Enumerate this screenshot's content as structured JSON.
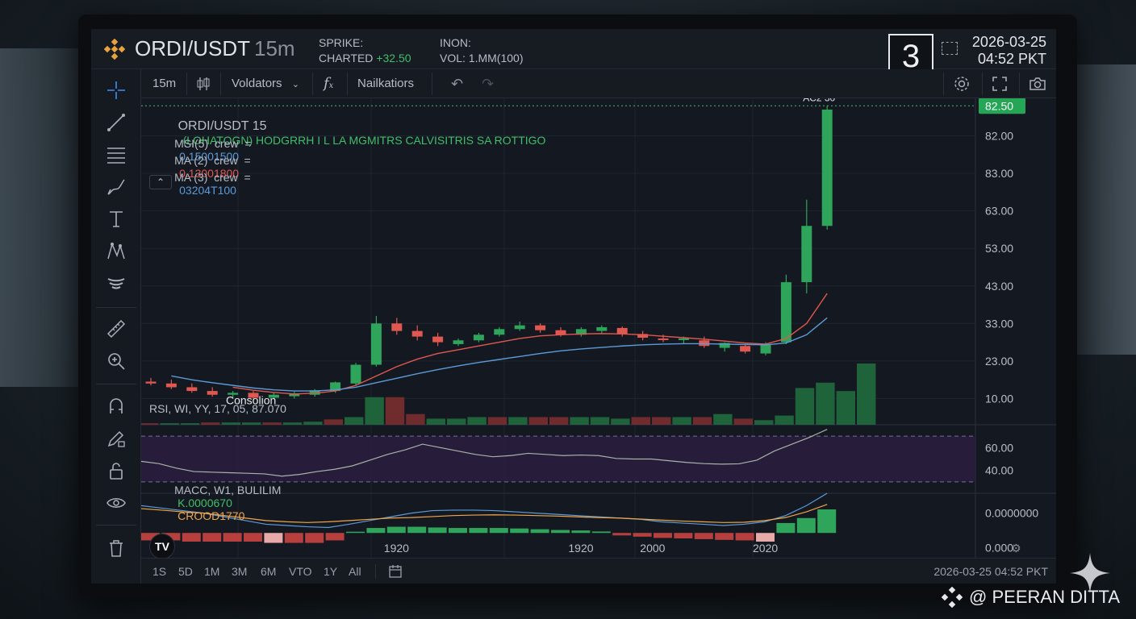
{
  "header": {
    "symbol": "ORDI/USDT",
    "timeframe": "15m",
    "block1_label": "SPRIKE:",
    "block1_line2_label": "CHARTED",
    "block1_change": "+32.50",
    "block2_label": "INON:",
    "block2_line2_label": "VOL:",
    "block2_value": "1.MM(100)",
    "big_number": "3",
    "date": "2026-03-25",
    "time": "04:52 PKT"
  },
  "toolbar": {
    "interval": "15m",
    "indicators_label": "Voldators",
    "fx_label": "f",
    "alerts_label": "Nailkatiors"
  },
  "legend": {
    "title": "ORDI/USDT 15",
    "title_extra": "(LOHATOGN) HODGRRH I L LA MGMITRS CALVISITRIS SA ROTTIGO",
    "rows": [
      {
        "label": "MSI(5)  crew  =",
        "value": "0.15001500",
        "color": "#5b9bd8"
      },
      {
        "label": "MA (2)  crew  =",
        "value": "0.13001800",
        "color": "#e0584f"
      },
      {
        "label": "MA (3)  crew  =",
        "value": "03204T100",
        "color": "#5b9bd8"
      }
    ],
    "collapse_icon": "chevron-up-icon"
  },
  "annotations": {
    "consolidation_label": "Consolion",
    "peak_label": "AC2 30",
    "current_price_tag": "82.50"
  },
  "chart_data": [
    {
      "type": "candlestick",
      "title": "ORDI/USDT 15",
      "price_axis_labels": [
        "82.00",
        "83.00",
        "63.00",
        "53.00",
        "43.00",
        "33.00",
        "23.00",
        "10.00"
      ],
      "price_axis_values": [
        93,
        83,
        73,
        63,
        53,
        43,
        33,
        23
      ],
      "x_labels": [
        "1920",
        "1920",
        "2000",
        "2020"
      ],
      "x_label_positions": [
        12,
        21,
        24.5,
        30
      ],
      "ylim": [
        16,
        103
      ],
      "candles": [
        {
          "o": 27.5,
          "h": 28.5,
          "l": 26.5,
          "c": 27
        },
        {
          "o": 27,
          "h": 28,
          "l": 25.5,
          "c": 26
        },
        {
          "o": 26,
          "h": 27,
          "l": 24.5,
          "c": 25
        },
        {
          "o": 25,
          "h": 26,
          "l": 23.5,
          "c": 24
        },
        {
          "o": 24,
          "h": 25,
          "l": 23,
          "c": 24.5
        },
        {
          "o": 24.5,
          "h": 25,
          "l": 22.5,
          "c": 23.2
        },
        {
          "o": 23.2,
          "h": 24.5,
          "l": 22.8,
          "c": 24
        },
        {
          "o": 23.6,
          "h": 24.8,
          "l": 23,
          "c": 24.3
        },
        {
          "o": 24,
          "h": 25.5,
          "l": 23.5,
          "c": 25.2
        },
        {
          "o": 25,
          "h": 27.5,
          "l": 24.5,
          "c": 27.3
        },
        {
          "o": 27,
          "h": 32.5,
          "l": 26.5,
          "c": 32
        },
        {
          "o": 32,
          "h": 45,
          "l": 31.5,
          "c": 43
        },
        {
          "o": 43,
          "h": 44.5,
          "l": 40,
          "c": 41
        },
        {
          "o": 41,
          "h": 42.5,
          "l": 38.5,
          "c": 39.5
        },
        {
          "o": 39.5,
          "h": 40.5,
          "l": 37,
          "c": 38
        },
        {
          "o": 37.5,
          "h": 39,
          "l": 37,
          "c": 38.5
        },
        {
          "o": 38.5,
          "h": 40.5,
          "l": 38,
          "c": 40
        },
        {
          "o": 40,
          "h": 42,
          "l": 39.5,
          "c": 41.5
        },
        {
          "o": 41.5,
          "h": 43.5,
          "l": 41,
          "c": 42.5
        },
        {
          "o": 42.5,
          "h": 43,
          "l": 40.5,
          "c": 41.2
        },
        {
          "o": 41.2,
          "h": 42,
          "l": 39.5,
          "c": 40
        },
        {
          "o": 40,
          "h": 42,
          "l": 39.5,
          "c": 41.5
        },
        {
          "o": 41,
          "h": 42.5,
          "l": 40.5,
          "c": 42
        },
        {
          "o": 41.8,
          "h": 42.2,
          "l": 39.5,
          "c": 40.2
        },
        {
          "o": 40.2,
          "h": 41,
          "l": 38.5,
          "c": 39.2
        },
        {
          "o": 39,
          "h": 40,
          "l": 38,
          "c": 38.6
        },
        {
          "o": 38.6,
          "h": 39.5,
          "l": 37.5,
          "c": 39
        },
        {
          "o": 38.5,
          "h": 39.5,
          "l": 36.5,
          "c": 37
        },
        {
          "o": 36.5,
          "h": 38,
          "l": 35.5,
          "c": 37.8
        },
        {
          "o": 37,
          "h": 37.5,
          "l": 35,
          "c": 35.5
        },
        {
          "o": 35,
          "h": 38,
          "l": 34.5,
          "c": 37.5
        },
        {
          "o": 38,
          "h": 56,
          "l": 37.5,
          "c": 54
        },
        {
          "o": 54,
          "h": 76,
          "l": 51,
          "c": 69
        },
        {
          "o": 69,
          "h": 101,
          "l": 68,
          "c": 100
        }
      ],
      "volumes": [
        2,
        2,
        2,
        3,
        3,
        3,
        3,
        3,
        4,
        7,
        10,
        36,
        36,
        14,
        8,
        8,
        10,
        10,
        10,
        10,
        10,
        10,
        10,
        8,
        10,
        10,
        10,
        10,
        14,
        8,
        6,
        12,
        48,
        55,
        44,
        80
      ],
      "moving_averages": [
        {
          "name": "MA (2)",
          "color": "#e0584f",
          "values": [
            null,
            null,
            null,
            null,
            26,
            25.2,
            24.6,
            24.2,
            24.4,
            25,
            26.5,
            29,
            31.5,
            33.5,
            35,
            36,
            37,
            38,
            39,
            39.7,
            40,
            40.2,
            40.3,
            40.2,
            40,
            39.6,
            39.2,
            38.8,
            38.3,
            37.8,
            37.5,
            39,
            43,
            51
          ]
        },
        {
          "name": "MSI(5)",
          "color": "#5b9bd8",
          "values": [
            null,
            29,
            28,
            27.2,
            26.5,
            25.8,
            25.3,
            25,
            25,
            25.3,
            26,
            27.2,
            28.4,
            29.6,
            30.7,
            31.7,
            32.6,
            33.4,
            34.2,
            35,
            35.7,
            36.2,
            36.6,
            37,
            37.3,
            37.5,
            37.6,
            37.6,
            37.5,
            37.4,
            37.3,
            37.8,
            40,
            44.5
          ]
        }
      ]
    },
    {
      "type": "line",
      "title": "RSI, WI, YY, 17, 05, 87.070",
      "y_axis_labels": [
        "60.00",
        "40.00"
      ],
      "y_axis_values": [
        60,
        40
      ],
      "band": [
        30,
        70
      ],
      "ylim": [
        20,
        80
      ],
      "values": [
        48,
        46,
        42,
        39,
        38.5,
        38,
        37.5,
        37,
        35,
        36.5,
        39,
        41,
        44,
        49,
        54,
        58,
        63,
        60,
        57,
        54,
        52,
        53,
        55,
        54,
        53,
        53.5,
        53,
        50.5,
        50,
        50,
        48.5,
        47,
        46,
        45.5,
        45.8,
        49,
        57,
        63,
        69,
        76
      ]
    },
    {
      "type": "macd",
      "title": "MACC, W1, BULILIM",
      "y_axis_labels": [
        "0.0000000",
        "0.000"
      ],
      "y_axis_values": [
        0.8,
        -0.6
      ],
      "ylim": [
        -1,
        1.6
      ],
      "histogram": [
        -0.3,
        -0.3,
        -0.35,
        -0.35,
        -0.35,
        -0.35,
        -0.4,
        -0.4,
        -0.4,
        -0.3,
        0.05,
        0.2,
        0.25,
        0.25,
        0.22,
        0.2,
        0.2,
        0.2,
        0.18,
        0.15,
        0.12,
        0.1,
        0.06,
        -0.1,
        -0.15,
        -0.2,
        -0.22,
        -0.25,
        -0.28,
        -0.3,
        -0.35,
        0.4,
        0.6,
        0.95
      ],
      "macd_line": [
        1.1,
        1,
        0.9,
        0.8,
        0.65,
        0.5,
        0.35,
        0.3,
        0.25,
        0.22,
        0.35,
        0.5,
        0.65,
        0.8,
        0.9,
        0.92,
        0.92,
        0.9,
        0.85,
        0.8,
        0.75,
        0.7,
        0.65,
        0.6,
        0.55,
        0.45,
        0.4,
        0.35,
        0.3,
        0.35,
        0.45,
        0.7,
        1.1,
        1.6
      ],
      "signal_line": [
        0.98,
        0.92,
        0.85,
        0.8,
        0.7,
        0.6,
        0.5,
        0.45,
        0.42,
        0.45,
        0.5,
        0.55,
        0.6,
        0.62,
        0.66,
        0.7,
        0.72,
        0.73,
        0.72,
        0.7,
        0.68,
        0.65,
        0.62,
        0.6,
        0.56,
        0.52,
        0.48,
        0.45,
        0.42,
        0.43,
        0.5,
        0.62,
        0.85,
        1.15
      ],
      "macd_color": "#5b9bd8",
      "signal_color": "#f0a64b",
      "macd_value_label": "K.0000670",
      "signal_value_label": "CROOD1770"
    }
  ],
  "bottom_bar": {
    "ranges": [
      "1S",
      "5D",
      "1M",
      "3M",
      "6M",
      "VTO",
      "1Y",
      "All"
    ],
    "datetime": "2026-03-25   04:52 PKT"
  },
  "watermark": "@ PEERAN DITTA",
  "colors": {
    "up": "#2ea55a",
    "down": "#e0584f",
    "bg": "#141820"
  }
}
